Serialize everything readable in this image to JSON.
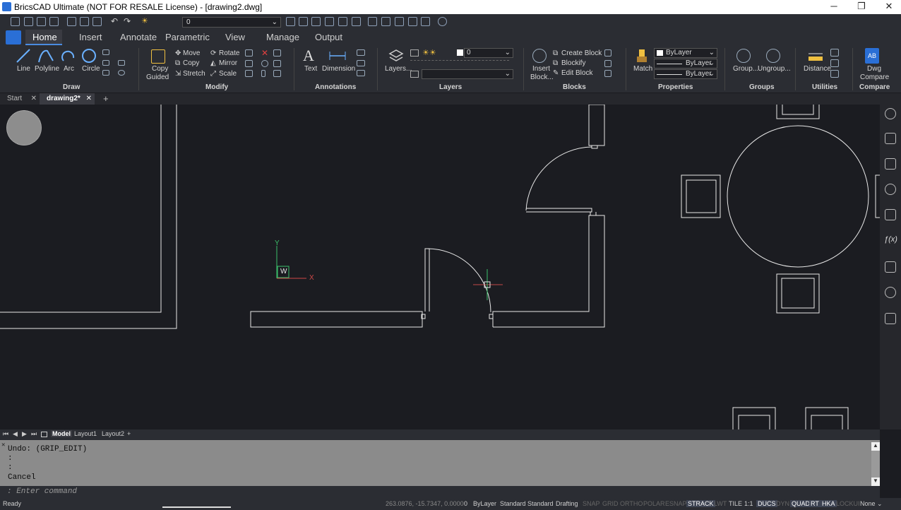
{
  "window": {
    "title": "BricsCAD Ultimate (NOT FOR RESALE License) - [drawing2.dwg]",
    "minimize": "─",
    "maximize": "❐",
    "close": "✕"
  },
  "qat": {
    "layer_value": "0"
  },
  "ribbon_tabs": [
    "Home",
    "Insert",
    "Annotate",
    "Parametric",
    "View",
    "Manage",
    "Output"
  ],
  "active_tab": "Home",
  "panels": {
    "draw": {
      "title": "Draw",
      "line": "Line",
      "polyline": "Polyline",
      "arc": "Arc",
      "circle": "Circle"
    },
    "modify": {
      "title": "Modify",
      "copy_guided_1": "Copy",
      "copy_guided_2": "Guided",
      "move": "Move",
      "rotate": "Rotate",
      "copy": "Copy",
      "mirror": "Mirror",
      "stretch": "Stretch",
      "scale": "Scale"
    },
    "annotations": {
      "title": "Annotations",
      "text": "Text",
      "dimension": "Dimension"
    },
    "layers": {
      "title": "Layers",
      "layers_btn": "Layers...",
      "layer_value": "0"
    },
    "blocks": {
      "title": "Blocks",
      "insert_1": "Insert",
      "insert_2": "Block...",
      "create_block": "Create Block",
      "blockify": "Blockify",
      "edit_block": "Edit Block"
    },
    "properties": {
      "title": "Properties",
      "match": "Match",
      "color": "ByLayer",
      "linetype": "ByLayer",
      "lineweight": "ByLayer"
    },
    "groups": {
      "title": "Groups",
      "group": "Group...",
      "ungroup": "Ungroup..."
    },
    "utilities": {
      "title": "Utilities",
      "distance": "Distance"
    },
    "compare": {
      "title": "Compare",
      "dwg_1": "Dwg",
      "dwg_2": "Compare"
    }
  },
  "doc_tabs": {
    "start": "Start",
    "drawing": "drawing2*",
    "add": "+"
  },
  "ucs": {
    "x": "X",
    "y": "Y",
    "w": "W"
  },
  "layout_tabs": {
    "model": "Model",
    "layout1": "Layout1",
    "layout2": "Layout2",
    "add": "+"
  },
  "command_history": [
    "Undo: (GRIP_EDIT)",
    ":",
    ":",
    "Cancel"
  ],
  "command_placeholder": ": Enter command",
  "status": {
    "ready": "Ready",
    "coords": "263.0876, -15.7347, 0.0000",
    "layer": "0",
    "bylayer": "ByLayer",
    "style1": "Standard",
    "style2": "Standard",
    "workspace": "Drafting",
    "toggles": [
      {
        "label": "SNAP",
        "on": false
      },
      {
        "label": "GRID",
        "on": false
      },
      {
        "label": "ORTHO",
        "on": false
      },
      {
        "label": "POLAR",
        "on": false
      },
      {
        "label": "ESNAP",
        "on": false
      },
      {
        "label": "STRACK",
        "on": true
      },
      {
        "label": "LWT",
        "on": false
      },
      {
        "label": "TILE",
        "on": true
      },
      {
        "label": "1:1",
        "on": true
      },
      {
        "label": "DUCS",
        "on": true
      },
      {
        "label": "DYN",
        "on": false
      },
      {
        "label": "QUAD",
        "on": true
      },
      {
        "label": "RT",
        "on": true
      },
      {
        "label": "HKA",
        "on": true
      },
      {
        "label": "LOCKUI",
        "on": false
      },
      {
        "label": "None",
        "on": true
      }
    ]
  }
}
